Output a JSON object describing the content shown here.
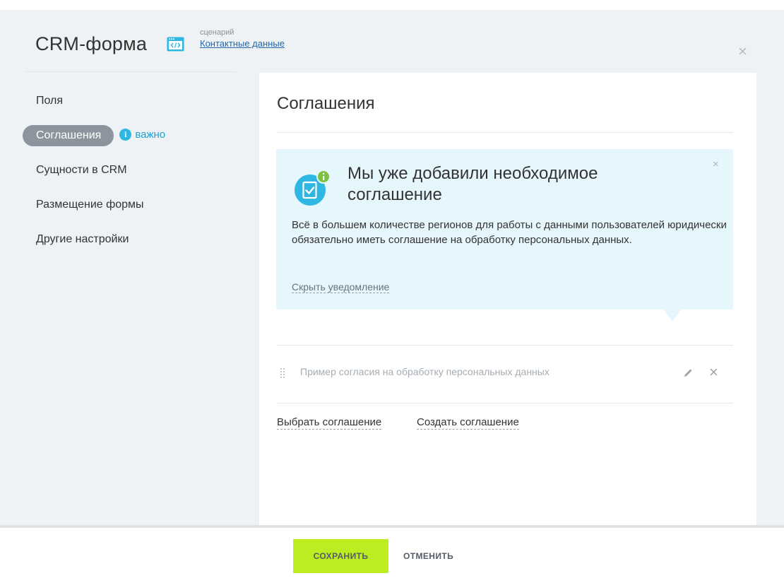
{
  "header": {
    "title": "CRM-форма",
    "scenario_label": "сценарий",
    "scenario_link": "Контактные данные",
    "close": "×"
  },
  "sidebar": {
    "items": [
      {
        "label": "Поля"
      },
      {
        "label": "Соглашения",
        "active": true,
        "badge": "важно"
      },
      {
        "label": "Сущности в CRM"
      },
      {
        "label": "Размещение формы"
      },
      {
        "label": "Другие настройки"
      }
    ],
    "info_glyph": "i"
  },
  "panel": {
    "title": "Соглашения",
    "notice": {
      "title": "Мы уже добавили необходимое соглашение",
      "text": "Всё в большем количестве регионов для работы с данными пользователей юридически обязательно иметь соглашение на обработку персональных данных.",
      "hide_link": "Скрыть уведомление",
      "close": "×",
      "icon": "document-check-icon"
    },
    "agreement": {
      "text": "Пример согласия на обработку персональных данных",
      "remove": "×"
    },
    "choose_link": "Выбрать соглашение",
    "create_link": "Создать соглашение"
  },
  "footer": {
    "save": "СОХРАНИТЬ",
    "cancel": "ОТМЕНИТЬ"
  },
  "colors": {
    "accent_green": "#bbed21",
    "notice_bg": "#e5f6fc",
    "info_blue": "#2fb7e4",
    "link_blue": "#2067b0"
  }
}
